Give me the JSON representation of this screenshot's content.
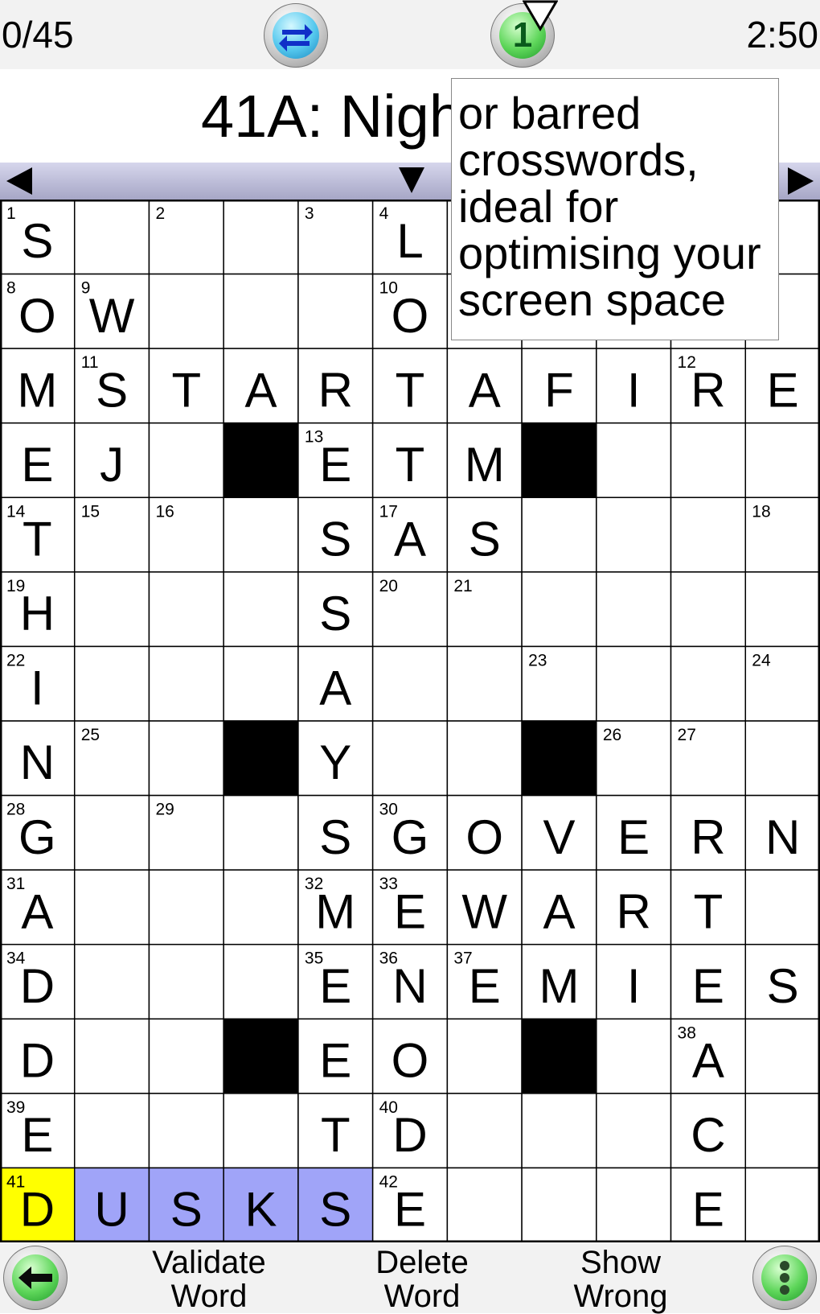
{
  "header": {
    "score": "0/45",
    "timer": "2:50",
    "hint_count": "1"
  },
  "clue": {
    "text": "41A: Nigh"
  },
  "tooltip": {
    "lines": [
      "or barred",
      "crosswords,",
      "ideal for",
      "optimising your",
      "screen space"
    ]
  },
  "nav": {
    "prev_icon": "left-triangle-icon",
    "next_icon": "right-triangle-icon"
  },
  "toolbar": {
    "validate_label": "Validate\nWord",
    "delete_label": "Delete\nWord",
    "show_wrong_label": "Show\nWrong"
  },
  "colors": {
    "selected_cell": "#ffff00",
    "selected_word": "#a0a4f8",
    "block": "#000000",
    "grid_line": "#000000"
  },
  "grid": {
    "size": 11,
    "rows": [
      "S....L.....",
      "OW...O.....",
      "MSTARTAFIRE",
      "EJ.#ETM#...",
      "T...SAS....",
      "H...S......",
      "I...A......",
      "N..#Y..#...",
      "G...SGOVERN",
      "A...MEWART.",
      "D...ENEMIES",
      "D..#EO.#.A.",
      "E...TD...C.",
      "DUSKSE...E."
    ],
    "numbers": [
      {
        "r": 0,
        "c": 0,
        "n": "1"
      },
      {
        "r": 0,
        "c": 2,
        "n": "2"
      },
      {
        "r": 0,
        "c": 4,
        "n": "3"
      },
      {
        "r": 0,
        "c": 5,
        "n": "4"
      },
      {
        "r": 1,
        "c": 0,
        "n": "8"
      },
      {
        "r": 1,
        "c": 1,
        "n": "9"
      },
      {
        "r": 1,
        "c": 5,
        "n": "10"
      },
      {
        "r": 2,
        "c": 1,
        "n": "11"
      },
      {
        "r": 2,
        "c": 9,
        "n": "12"
      },
      {
        "r": 3,
        "c": 4,
        "n": "13"
      },
      {
        "r": 4,
        "c": 0,
        "n": "14"
      },
      {
        "r": 4,
        "c": 1,
        "n": "15"
      },
      {
        "r": 4,
        "c": 2,
        "n": "16"
      },
      {
        "r": 4,
        "c": 5,
        "n": "17"
      },
      {
        "r": 4,
        "c": 10,
        "n": "18"
      },
      {
        "r": 5,
        "c": 0,
        "n": "19"
      },
      {
        "r": 5,
        "c": 5,
        "n": "20"
      },
      {
        "r": 5,
        "c": 6,
        "n": "21"
      },
      {
        "r": 6,
        "c": 0,
        "n": "22"
      },
      {
        "r": 6,
        "c": 7,
        "n": "23"
      },
      {
        "r": 6,
        "c": 10,
        "n": "24"
      },
      {
        "r": 7,
        "c": 1,
        "n": "25"
      },
      {
        "r": 7,
        "c": 8,
        "n": "26"
      },
      {
        "r": 7,
        "c": 9,
        "n": "27"
      },
      {
        "r": 8,
        "c": 0,
        "n": "28"
      },
      {
        "r": 8,
        "c": 2,
        "n": "29"
      },
      {
        "r": 8,
        "c": 5,
        "n": "30"
      },
      {
        "r": 9,
        "c": 0,
        "n": "31"
      },
      {
        "r": 9,
        "c": 4,
        "n": "32"
      },
      {
        "r": 9,
        "c": 5,
        "n": "33"
      },
      {
        "r": 10,
        "c": 0,
        "n": "34"
      },
      {
        "r": 10,
        "c": 4,
        "n": "35"
      },
      {
        "r": 10,
        "c": 5,
        "n": "36"
      },
      {
        "r": 10,
        "c": 6,
        "n": "37"
      },
      {
        "r": 11,
        "c": 9,
        "n": "38"
      },
      {
        "r": 12,
        "c": 0,
        "n": "39"
      },
      {
        "r": 12,
        "c": 5,
        "n": "40"
      },
      {
        "r": 13,
        "c": 0,
        "n": "41"
      },
      {
        "r": 13,
        "c": 5,
        "n": "42"
      }
    ],
    "selected": {
      "r": 13,
      "c": 0
    },
    "word": [
      {
        "r": 13,
        "c": 1
      },
      {
        "r": 13,
        "c": 2
      },
      {
        "r": 13,
        "c": 3
      },
      {
        "r": 13,
        "c": 4
      }
    ]
  }
}
